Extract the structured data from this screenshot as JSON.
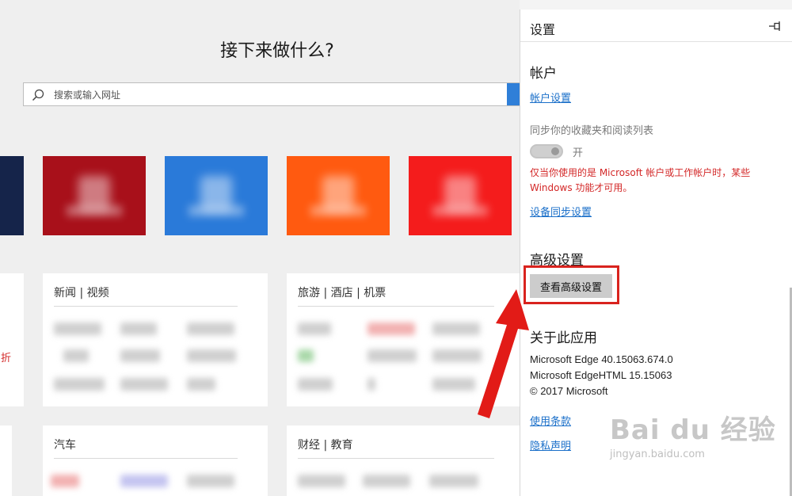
{
  "new_tab": {
    "headline": "接下来做什么?",
    "search_placeholder": "搜索或输入网址",
    "tile_colors": [
      "#15244a",
      "#a8101a",
      "#2a7ad9",
      "#ff5a10",
      "#f41c1c"
    ],
    "cards": [
      {
        "title": "新闻 | 视频"
      },
      {
        "title": "旅游 | 酒店 | 机票"
      },
      {
        "title": "汽车"
      },
      {
        "title": "财经 | 教育"
      }
    ],
    "left_edge_text": "折"
  },
  "settings_panel": {
    "title": "设置",
    "pin_icon": "pin-icon",
    "account": {
      "heading": "帐户",
      "account_settings_link": "帐户设置",
      "sync_label": "同步你的收藏夹和阅读列表",
      "toggle_state_label": "开",
      "warning": "仅当你使用的是 Microsoft 帐户或工作帐户时，某些 Windows 功能才可用。",
      "device_sync_link": "设备同步设置"
    },
    "advanced": {
      "heading": "高级设置",
      "view_button": "查看高级设置"
    },
    "about": {
      "heading": "关于此应用",
      "edge_version": "Microsoft Edge 40.15063.674.0",
      "edgehtml_version": "Microsoft EdgeHTML 15.15063",
      "copyright": "© 2017 Microsoft",
      "terms_link": "使用条款",
      "privacy_link": "隐私声明"
    }
  },
  "watermark": {
    "brand": "Bai du 经验",
    "url": "jingyan.baidu.com"
  },
  "colors": {
    "link": "#1a6fc9",
    "warning": "#d32727",
    "highlight_box": "#d9231e",
    "arrow": "#e21b17"
  }
}
